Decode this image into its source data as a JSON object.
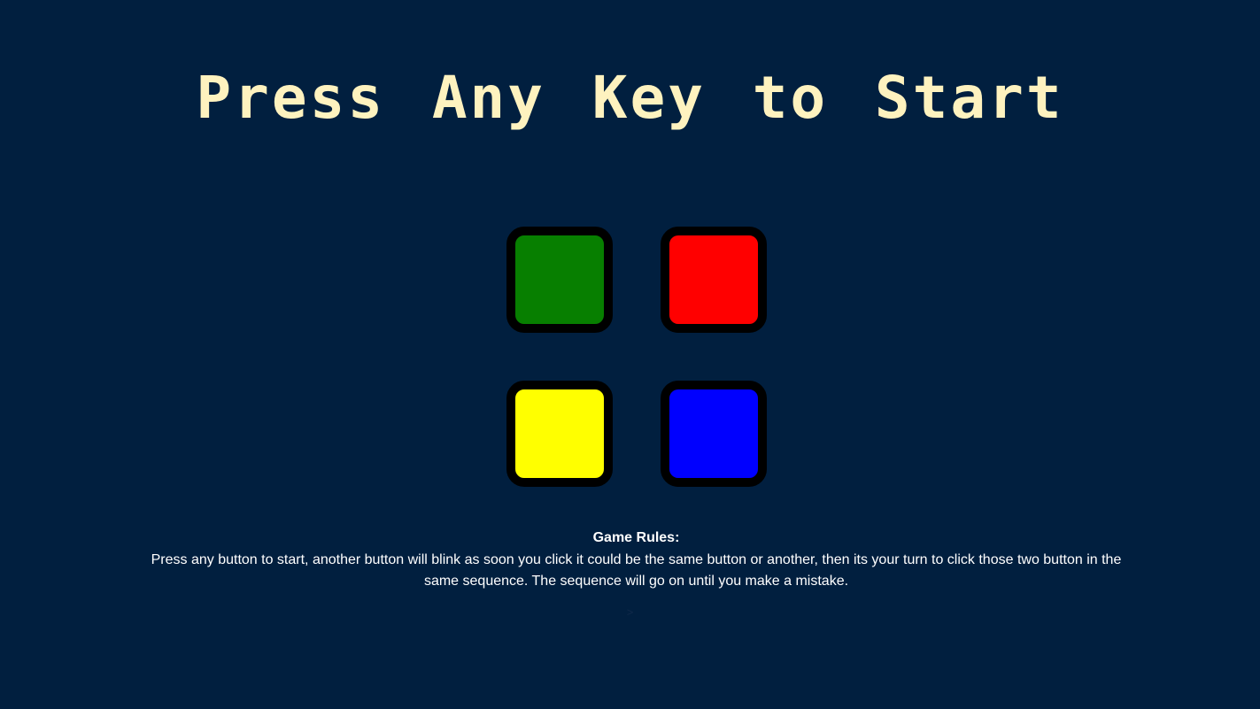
{
  "title": "Press Any Key to Start",
  "buttons": [
    {
      "id": "green",
      "color": "#077f00"
    },
    {
      "id": "red",
      "color": "#ff0000"
    },
    {
      "id": "yellow",
      "color": "#ffff00"
    },
    {
      "id": "blue",
      "color": "#0000ff"
    }
  ],
  "rules": {
    "heading": "Game Rules:",
    "text": "Press any button to start, another button will blink as soon you click it could be the same button or another, then its your turn to click those two button in the same sequence. The sequence will go on until you make a mistake."
  },
  "footer": {
    "mark": ">"
  },
  "colors": {
    "background": "#011f3f",
    "title": "#fef2bf",
    "border": "#000000"
  }
}
